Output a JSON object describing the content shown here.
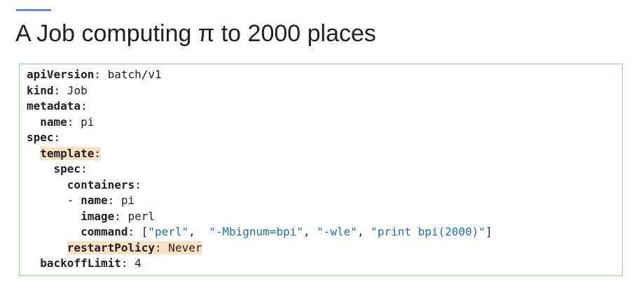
{
  "slide": {
    "title": "A Job computing π to 2000 places",
    "accent_color": "#5b8def",
    "box_border_color": "#8fcf8f",
    "highlight_color": "#fbe0c3",
    "string_color": "#1c6fa8"
  },
  "code": {
    "l1_key": "apiVersion",
    "l1_colon": ":",
    "l1_value": " batch/v1",
    "l2_key": "kind",
    "l2_colon": ":",
    "l2_value": " Job",
    "l3_key": "metadata",
    "l3_colon": ":",
    "l4_indent": "  ",
    "l4_key": "name",
    "l4_colon": ":",
    "l4_value": " pi",
    "l5_key": "spec",
    "l5_colon": ":",
    "l6_indent": "  ",
    "l6_key": "template",
    "l6_colon": ":",
    "l7_indent": "    ",
    "l7_key": "spec",
    "l7_colon": ":",
    "l8_indent": "      ",
    "l8_key": "containers",
    "l8_colon": ":",
    "l9_indent": "      - ",
    "l9_key": "name",
    "l9_colon": ":",
    "l9_value": " pi",
    "l10_indent": "        ",
    "l10_key": "image",
    "l10_colon": ":",
    "l10_value": " perl",
    "l11_indent": "        ",
    "l11_key": "command",
    "l11_colon": ":",
    "l11_open": " [",
    "l11_s1": "\"perl\"",
    "l11_sep1": ",  ",
    "l11_s2": "\"-Mbignum=bpi\"",
    "l11_sep2": ", ",
    "l11_s3": "\"-wle\"",
    "l11_sep3": ", ",
    "l11_s4": "\"print bpi(2000)\"",
    "l11_close": "]",
    "l12_indent": "      ",
    "l12_key": "restartPolicy",
    "l12_colon": ":",
    "l12_value": " Never",
    "l13_indent": "  ",
    "l13_key": "backoffLimit",
    "l13_colon": ":",
    "l13_value": " 4"
  }
}
